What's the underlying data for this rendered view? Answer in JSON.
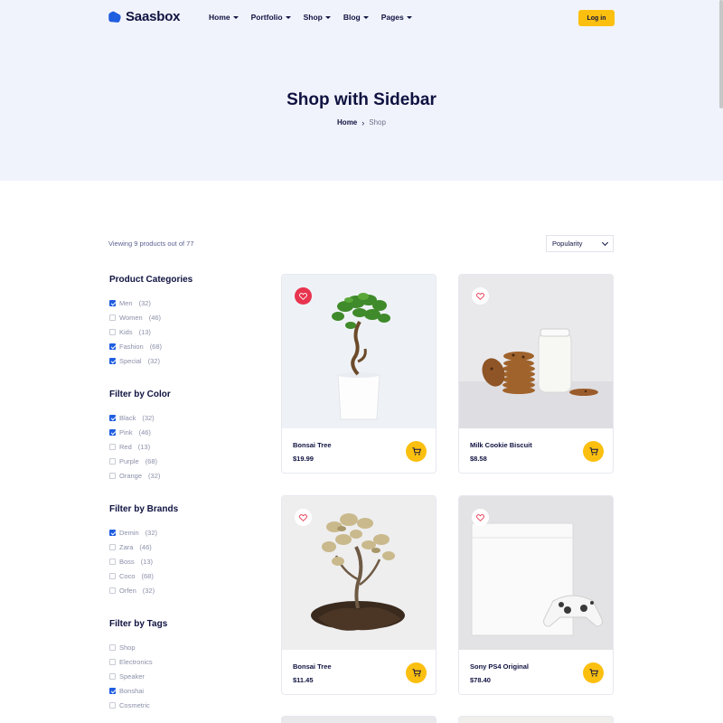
{
  "header": {
    "logo_text": "Saasbox",
    "menu": [
      {
        "label": "Home"
      },
      {
        "label": "Portfolio"
      },
      {
        "label": "Shop"
      },
      {
        "label": "Blog"
      },
      {
        "label": "Pages"
      }
    ],
    "login_label": "Log in"
  },
  "hero": {
    "title": "Shop with Sidebar",
    "breadcrumb": {
      "home": "Home",
      "separator": "›",
      "current": "Shop"
    }
  },
  "toolbar": {
    "viewing_text": "Viewing 9 products out of 77",
    "sort_selected": "Popularity"
  },
  "filters": [
    {
      "title": "Product Categories",
      "items": [
        {
          "label": "Men",
          "count": "(32)",
          "checked": true
        },
        {
          "label": "Women",
          "count": "(46)",
          "checked": false
        },
        {
          "label": "Kids",
          "count": "(13)",
          "checked": false
        },
        {
          "label": "Fashion",
          "count": "(68)",
          "checked": true
        },
        {
          "label": "Special",
          "count": "(32)",
          "checked": true
        }
      ]
    },
    {
      "title": "Filter by Color",
      "items": [
        {
          "label": "Black",
          "count": "(32)",
          "checked": true
        },
        {
          "label": "Pink",
          "count": "(46)",
          "checked": true
        },
        {
          "label": "Red",
          "count": "(13)",
          "checked": false
        },
        {
          "label": "Purple",
          "count": "(68)",
          "checked": false
        },
        {
          "label": "Orange",
          "count": "(32)",
          "checked": false
        }
      ]
    },
    {
      "title": "Filter by Brands",
      "items": [
        {
          "label": "Demin",
          "count": "(32)",
          "checked": true
        },
        {
          "label": "Zara",
          "count": "(46)",
          "checked": false
        },
        {
          "label": "Boss",
          "count": "(13)",
          "checked": false
        },
        {
          "label": "Coco",
          "count": "(68)",
          "checked": false
        },
        {
          "label": "Orfen",
          "count": "(32)",
          "checked": false
        }
      ]
    },
    {
      "title": "Filter by Tags",
      "items": [
        {
          "label": "Shop",
          "count": "",
          "checked": false
        },
        {
          "label": "Electronics",
          "count": "",
          "checked": false
        },
        {
          "label": "Speaker",
          "count": "",
          "checked": false
        },
        {
          "label": "Bonshai",
          "count": "",
          "checked": true
        },
        {
          "label": "Cosmetric",
          "count": "",
          "checked": false
        }
      ]
    }
  ],
  "products": [
    {
      "name": "Bonsai Tree",
      "price": "$19.99",
      "favorite": true,
      "image": "bonsai-pot"
    },
    {
      "name": "Milk Cookie Biscuit",
      "price": "$8.58",
      "favorite": false,
      "image": "cookies-milk"
    },
    {
      "name": "Bonsai Tree",
      "price": "$11.45",
      "favorite": false,
      "image": "bonsai-roots"
    },
    {
      "name": "Sony PS4 Original",
      "price": "$78.40",
      "favorite": false,
      "image": "ps4-console"
    }
  ],
  "colors": {
    "accent": "#fbbf0f",
    "brand_blue": "#1f5de0",
    "favorite_red": "#e8344e",
    "text_dark": "#0f1240",
    "hero_bg": "#f1f3fc"
  },
  "icons": {
    "logo": "cloud-logo-icon",
    "cart": "shopping-cart-icon",
    "favorite": "heart-icon",
    "dropdown": "chevron-down-icon"
  }
}
